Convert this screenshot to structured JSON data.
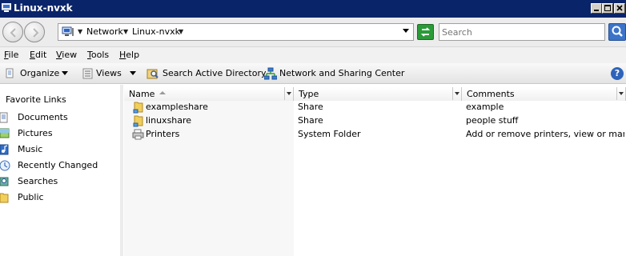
{
  "window": {
    "title": "Linux-nvxk"
  },
  "address": {
    "crumbs": [
      "Network",
      "Linux-nvxk"
    ],
    "search_placeholder": "Search"
  },
  "menu": [
    {
      "key": "F",
      "rest": "ile"
    },
    {
      "key": "E",
      "rest": "dit"
    },
    {
      "key": "V",
      "rest": "iew"
    },
    {
      "key": "T",
      "rest": "ools"
    },
    {
      "key": "H",
      "rest": "elp"
    }
  ],
  "commands": {
    "organize": "Organize",
    "views": "Views",
    "search_ad": "Search Active Directory",
    "network_sharing": "Network and Sharing Center"
  },
  "nav": {
    "title": "Favorite Links",
    "items": [
      {
        "label": "Documents",
        "icon": "documents-icon"
      },
      {
        "label": "Pictures",
        "icon": "pictures-icon"
      },
      {
        "label": "Music",
        "icon": "music-icon"
      },
      {
        "label": "Recently Changed",
        "icon": "recently-changed-icon"
      },
      {
        "label": "Searches",
        "icon": "searches-icon"
      },
      {
        "label": "Public",
        "icon": "public-folder-icon"
      }
    ]
  },
  "columns": {
    "name": "Name",
    "type": "Type",
    "comments": "Comments"
  },
  "rows": [
    {
      "name": "exampleshare",
      "type": "Share",
      "comments": "example",
      "icon": "share-folder-icon"
    },
    {
      "name": "linuxshare",
      "type": "Share",
      "comments": "people stuff",
      "icon": "share-folder-icon"
    },
    {
      "name": "Printers",
      "type": "System Folder",
      "comments": "Add or remove printers, view or mana...",
      "icon": "printers-icon"
    }
  ],
  "colors": {
    "titlebar": "#0a246a",
    "refresh": "#2b9a38",
    "search_button": "#3b74c9"
  }
}
